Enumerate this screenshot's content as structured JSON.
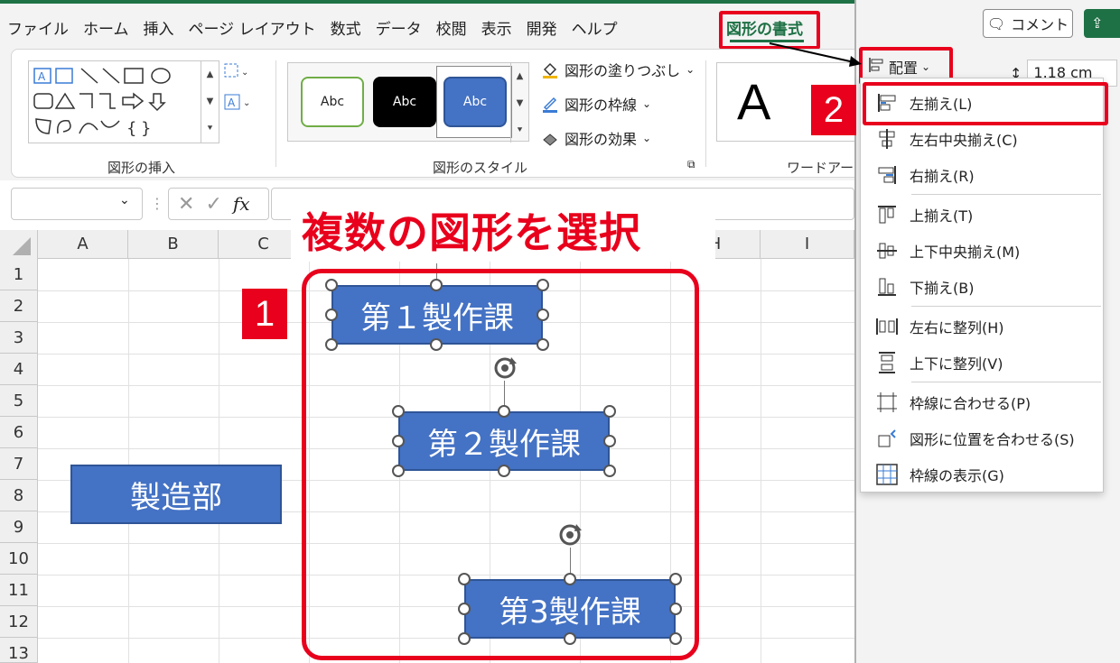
{
  "ribbon": {
    "tabs": [
      "ファイル",
      "ホーム",
      "挿入",
      "ページ レイアウト",
      "数式",
      "データ",
      "校閲",
      "表示",
      "開発",
      "ヘルプ"
    ],
    "active_tab": "図形の書式",
    "groups": {
      "insert_shapes": "図形の挿入",
      "shape_styles": "図形のスタイル",
      "wordart": "ワードアート"
    },
    "style_swatches": [
      "Abc",
      "Abc",
      "Abc"
    ],
    "commands": {
      "fill": "図形の塗りつぶし",
      "outline": "図形の枠線",
      "effects": "図形の効果"
    },
    "wordart_glyph": "A",
    "comment_button": "コメント",
    "arrange_button": "配置",
    "height_value": "1.18 cm"
  },
  "formula_bar": {
    "fx": "fx"
  },
  "grid": {
    "columns": [
      "A",
      "B",
      "C",
      "H",
      "I"
    ],
    "rows": [
      "1",
      "2",
      "3",
      "4",
      "5",
      "6",
      "7",
      "8",
      "9",
      "10",
      "11",
      "12",
      "13"
    ]
  },
  "shapes": {
    "shape1": "第１製作課",
    "shape2": "第２製作課",
    "shape3": "第3製作課",
    "shape_dept": "製造部"
  },
  "annotations": {
    "title": "複数の図形を選択",
    "badge1": "1",
    "badge2": "2"
  },
  "menu": {
    "items": [
      {
        "label": "左揃え(L)",
        "icon": "align-left-icon"
      },
      {
        "label": "左右中央揃え(C)",
        "icon": "align-center-icon"
      },
      {
        "label": "右揃え(R)",
        "icon": "align-right-icon"
      },
      {
        "label": "上揃え(T)",
        "icon": "align-top-icon"
      },
      {
        "label": "上下中央揃え(M)",
        "icon": "align-middle-icon"
      },
      {
        "label": "下揃え(B)",
        "icon": "align-bottom-icon"
      },
      {
        "label": "左右に整列(H)",
        "icon": "distribute-horizontal-icon"
      },
      {
        "label": "上下に整列(V)",
        "icon": "distribute-vertical-icon"
      },
      {
        "label": "枠線に合わせる(P)",
        "icon": "snap-to-grid-icon"
      },
      {
        "label": "図形に位置を合わせる(S)",
        "icon": "snap-to-shape-icon"
      },
      {
        "label": "枠線の表示(G)",
        "icon": "view-gridlines-icon"
      }
    ]
  },
  "colors": {
    "accent_red": "#e8001c",
    "excel_green": "#1e7145",
    "shape_blue": "#4472c4"
  }
}
